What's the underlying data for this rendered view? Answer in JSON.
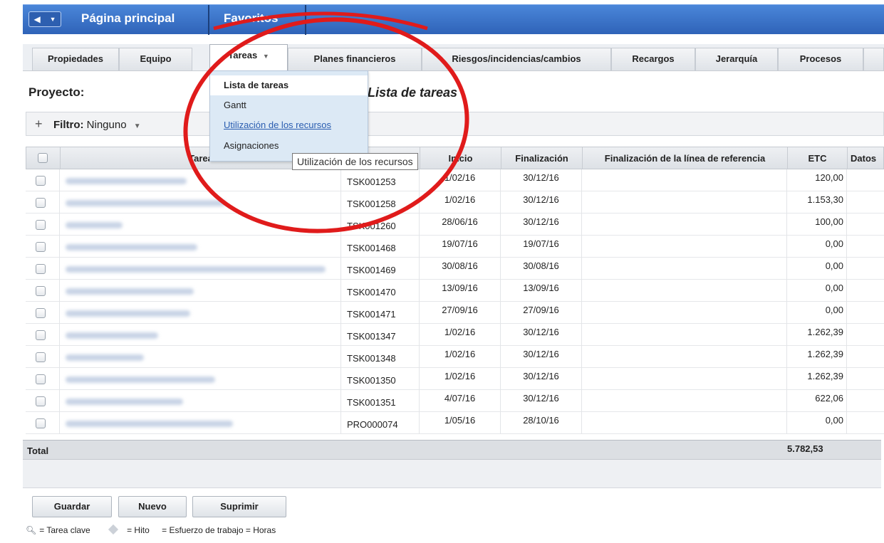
{
  "topbar": {
    "home": "Página principal",
    "favorites": "Favoritos"
  },
  "tabs": [
    {
      "label": "Propiedades"
    },
    {
      "label": "Equipo"
    },
    {
      "label": "Tareas"
    },
    {
      "label": "Planes financieros"
    },
    {
      "label": "Riesgos/incidencias/cambios"
    },
    {
      "label": "Recargos"
    },
    {
      "label": "Jerarquía"
    },
    {
      "label": "Procesos"
    }
  ],
  "page": {
    "project_label": "Proyecto:",
    "title": "Lista de tareas"
  },
  "filter": {
    "label": "Filtro:",
    "value": "Ninguno"
  },
  "menu": {
    "items": [
      "Lista de tareas",
      "Gantt",
      "Utilización de los recursos",
      "Asignaciones"
    ],
    "tooltip": "Utilización de los recursos"
  },
  "grid": {
    "headers": {
      "tarea": "Tarea",
      "inicio": "Inicio",
      "fin": "Finalización",
      "ref": "Finalización de la línea de referencia",
      "etc": "ETC",
      "datos": "Datos"
    },
    "rows": [
      {
        "id": "TSK001253",
        "inicio": "1/02/16",
        "fin": "30/12/16",
        "etc": "120,00"
      },
      {
        "id": "TSK001258",
        "inicio": "1/02/16",
        "fin": "30/12/16",
        "etc": "1.153,30"
      },
      {
        "id": "TSK001260",
        "inicio": "28/06/16",
        "fin": "30/12/16",
        "etc": "100,00"
      },
      {
        "id": "TSK001468",
        "inicio": "19/07/16",
        "fin": "19/07/16",
        "etc": "0,00"
      },
      {
        "id": "TSK001469",
        "inicio": "30/08/16",
        "fin": "30/08/16",
        "etc": "0,00"
      },
      {
        "id": "TSK001470",
        "inicio": "13/09/16",
        "fin": "13/09/16",
        "etc": "0,00"
      },
      {
        "id": "TSK001471",
        "inicio": "27/09/16",
        "fin": "27/09/16",
        "etc": "0,00"
      },
      {
        "id": "TSK001347",
        "inicio": "1/02/16",
        "fin": "30/12/16",
        "etc": "1.262,39"
      },
      {
        "id": "TSK001348",
        "inicio": "1/02/16",
        "fin": "30/12/16",
        "etc": "1.262,39"
      },
      {
        "id": "TSK001350",
        "inicio": "1/02/16",
        "fin": "30/12/16",
        "etc": "1.262,39"
      },
      {
        "id": "TSK001351",
        "inicio": "4/07/16",
        "fin": "30/12/16",
        "etc": "622,06"
      },
      {
        "id": "PRO000074",
        "inicio": "1/05/16",
        "fin": "28/10/16",
        "etc": "0,00"
      }
    ],
    "total_label": "Total",
    "total_etc": "5.782,53"
  },
  "buttons": {
    "save": "Guardar",
    "new": "Nuevo",
    "delete": "Suprimir"
  },
  "legend": {
    "key_task": "= Tarea clave",
    "milestone": "= Hito",
    "effort": "= Esfuerzo de trabajo = Horas"
  }
}
